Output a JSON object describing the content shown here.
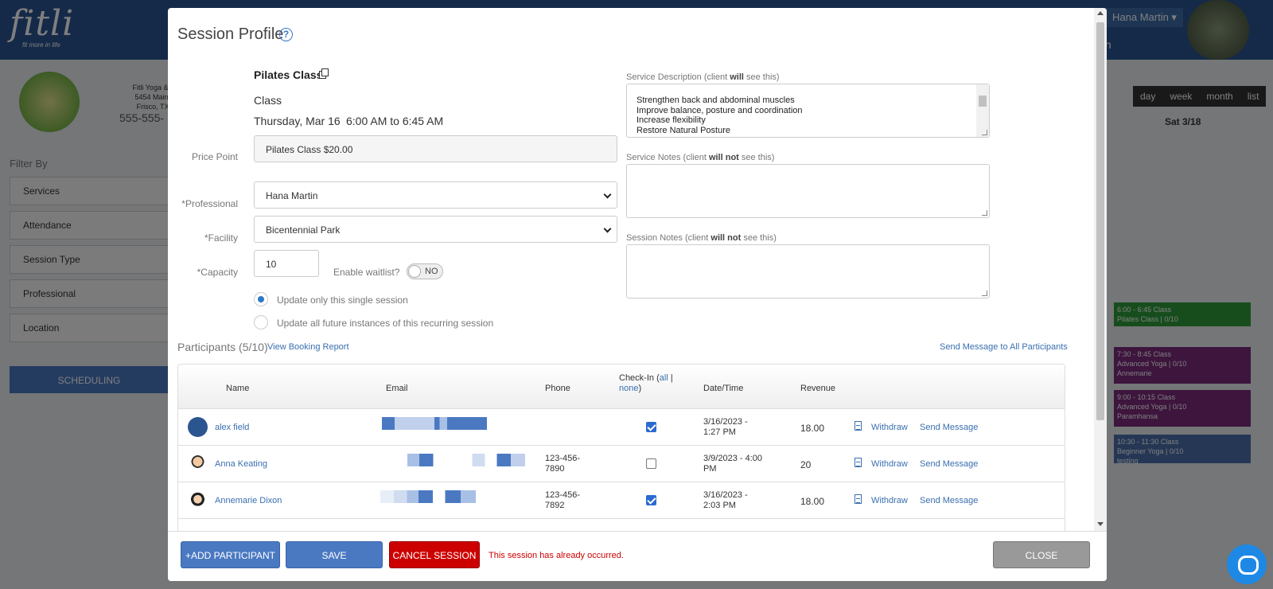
{
  "background": {
    "logo": "fitli",
    "logo_sub": "fit more in life",
    "user_menu": "Hana Martin ▾",
    "user_role": "nin",
    "studio_lines": [
      "Fitli Yoga & P",
      "5454 Main S",
      "Frisco, TX 7"
    ],
    "studio_phone": "555-555-",
    "filter_label": "Filter By",
    "filters": [
      "Services",
      "Attendance",
      "Session Type",
      "Professional",
      "Location"
    ],
    "scheduling_button": "SCHEDULING",
    "views": [
      "day",
      "week",
      "month",
      "list"
    ],
    "day_header": "Sat 3/18",
    "events": [
      {
        "time": "6:00 - 6:45",
        "type": "Class",
        "title": "Pilates Class | 0/10",
        "sub": "",
        "color": "#2e9a3a"
      },
      {
        "time": "7:30 - 8:45",
        "type": "Class",
        "title": "Advanced Yoga | 0/10",
        "sub": "Annemarie",
        "color": "#7a2a7a"
      },
      {
        "time": "9:00 - 10:15",
        "type": "Class",
        "title": "Advanced Yoga | 0/10",
        "sub": "Paramhansa",
        "color": "#7a2a7a"
      },
      {
        "time": "10:30 - 11:30",
        "type": "Class",
        "title": "Beginner Yoga | 0/10",
        "sub": "testing",
        "color": "#4a6ea8"
      }
    ]
  },
  "modal": {
    "title": "Session Profile",
    "help_icon": "?",
    "service_name": "Pilates Class",
    "service_type": "Class",
    "date": "Thursday, Mar 16",
    "time": "6:00 AM to 6:45 AM",
    "price_point_label": "Price Point",
    "price_point_value": "Pilates Class $20.00",
    "professional_label": "*Professional",
    "professional_value": "Hana Martin",
    "facility_label": "*Facility",
    "facility_value": "Bicentennial Park",
    "capacity_label": "*Capacity",
    "capacity_value": "10",
    "waitlist_label": "Enable waitlist?",
    "waitlist_toggle": "NO",
    "radio_single": "Update only this single session",
    "radio_all": "Update all future instances of this recurring session",
    "service_description_label_a": "Service Description (client ",
    "service_description_label_b": "will",
    "service_description_label_c": " see this)",
    "service_description_text": "Strengthen back and abdominal muscles\nImprove balance, posture and coordination\nIncrease flexibility\nRestore Natural Posture",
    "service_notes_label_a": "Service Notes (client ",
    "service_notes_label_b": "will not",
    "service_notes_label_c": " see this)",
    "session_notes_label_a": "Session Notes (client ",
    "session_notes_label_b": "will not",
    "session_notes_label_c": " see this)",
    "participants_title": "Participants (5/10)",
    "view_booking_report": "View Booking Report",
    "send_message_all": "Send Message to All Participants",
    "columns": {
      "name": "Name",
      "email": "Email",
      "phone": "Phone",
      "checkin_a": "Check-In",
      "checkin_all": "all",
      "checkin_sep": "|",
      "checkin_none": "none",
      "datetime": "Date/Time",
      "revenue": "Revenue"
    },
    "participants": [
      {
        "name": "alex field",
        "phone_1": "",
        "phone_2": "",
        "checked": true,
        "dt_1": "3/16/2023 -",
        "dt_2": "1:27 PM",
        "revenue": "18.00",
        "withdraw": "Withdraw",
        "send": "Send Message"
      },
      {
        "name": "Anna Keating",
        "phone_1": "123-456-",
        "phone_2": "7890",
        "checked": false,
        "dt_1": "3/9/2023 - 4:00",
        "dt_2": "PM",
        "revenue": "20",
        "withdraw": "Withdraw",
        "send": "Send Message"
      },
      {
        "name": "Annemarie Dixon",
        "phone_1": "123-456-",
        "phone_2": "7892",
        "checked": true,
        "dt_1": "3/16/2023 -",
        "dt_2": "2:03 PM",
        "revenue": "18.00",
        "withdraw": "Withdraw",
        "send": "Send Message"
      }
    ],
    "buttons": {
      "add_participant": "+ADD PARTICIPANT",
      "save": "SAVE",
      "cancel_session": "CANCEL SESSION",
      "close": "CLOSE"
    },
    "warning": "This session has already occurred."
  }
}
